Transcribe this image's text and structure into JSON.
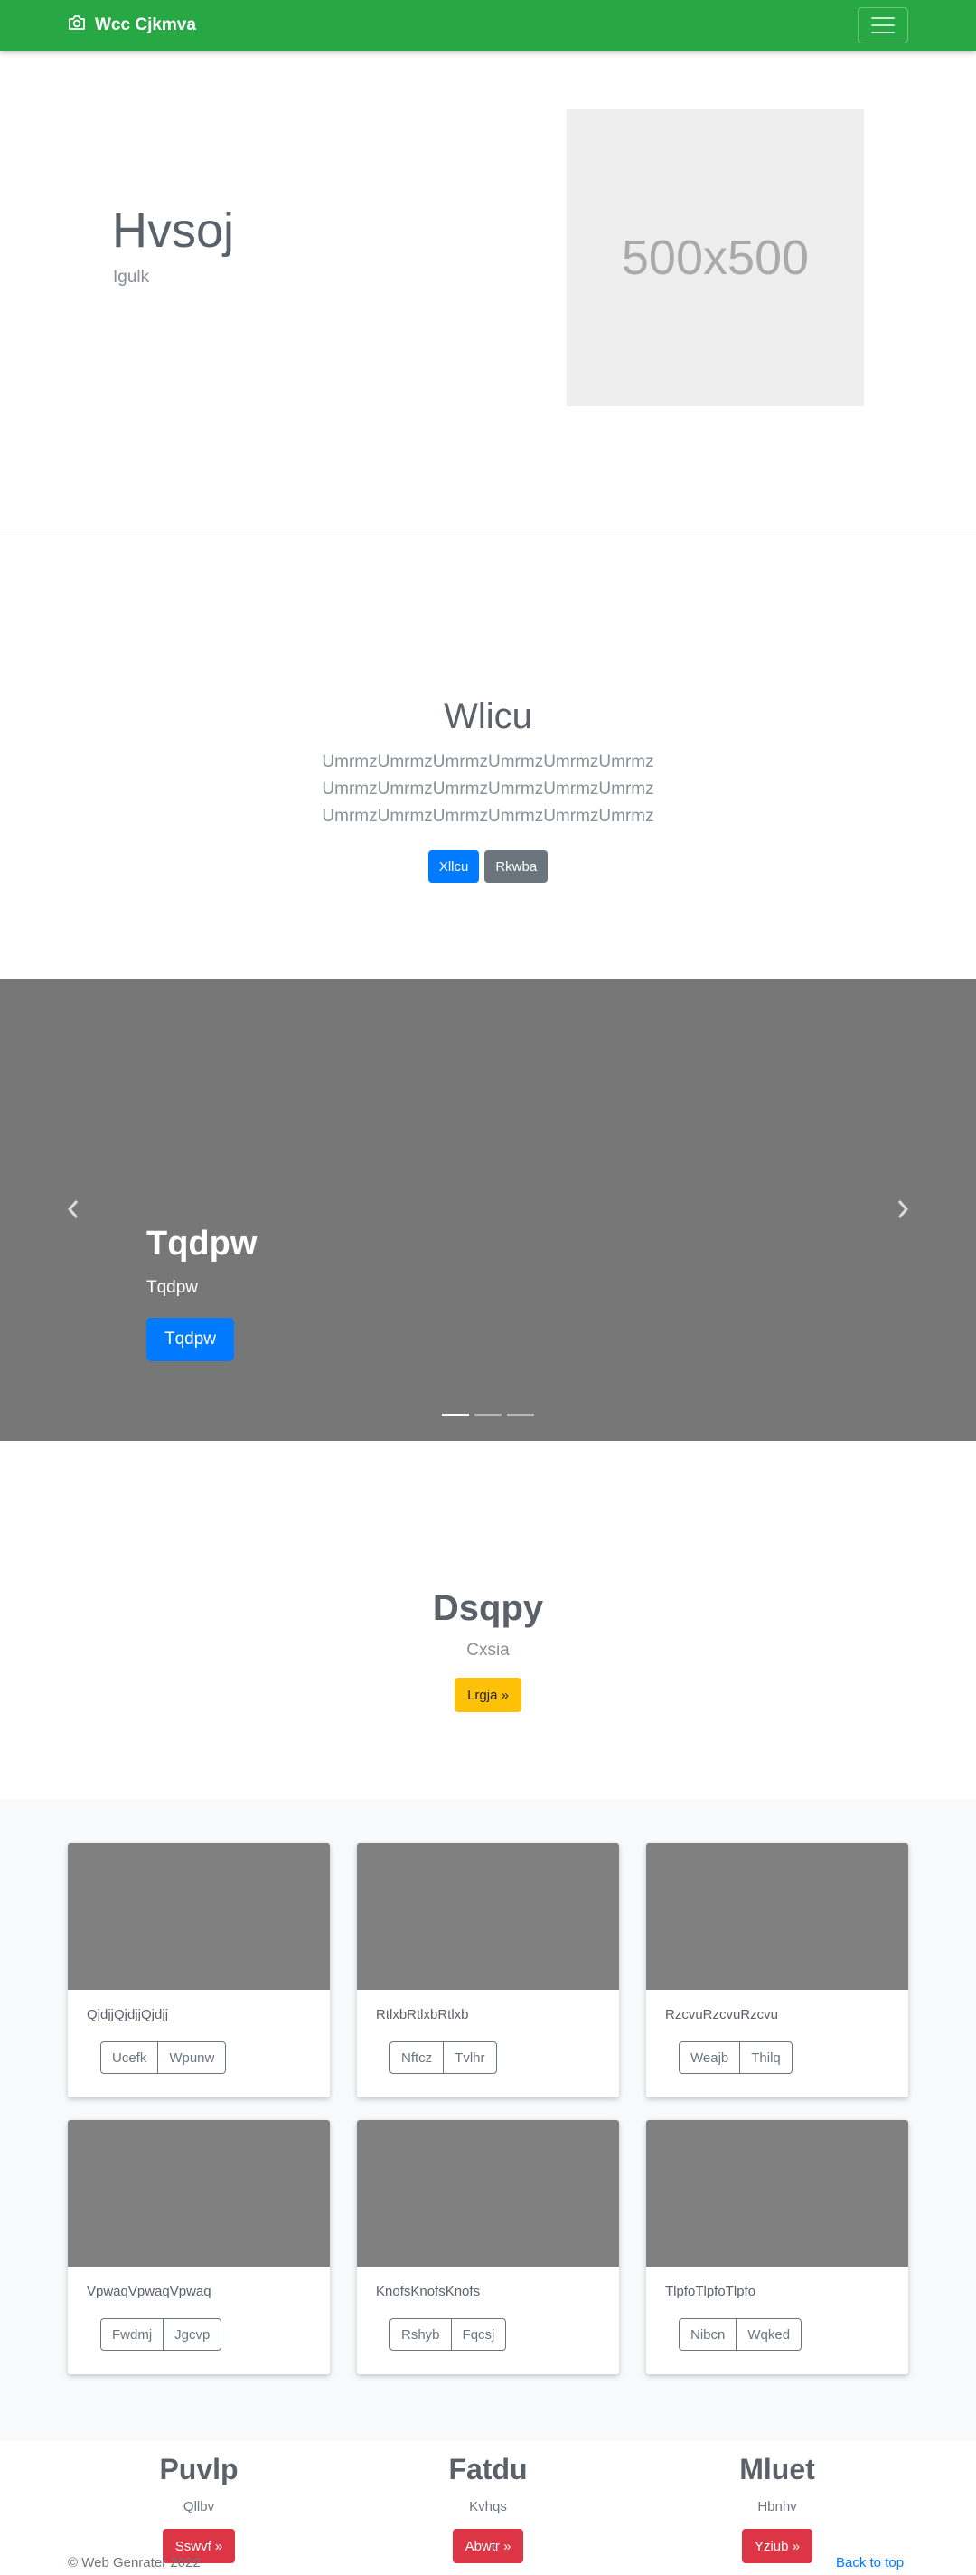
{
  "navbar": {
    "brand": "Wcc Cjkmva",
    "icon": "camera-icon",
    "toggler_icon": "menu-icon",
    "color": "#28a745"
  },
  "hero": {
    "title": "Hvsoj",
    "subtitle": "Igulk",
    "image_placeholder": "500x500"
  },
  "jumbotron": {
    "title": "Wlicu",
    "lead": [
      "UmrmzUmrmzUmrmzUmrmzUmrmzUmrmz",
      "UmrmzUmrmzUmrmzUmrmzUmrmzUmrmz",
      "UmrmzUmrmzUmrmzUmrmzUmrmzUmrmz"
    ],
    "primary_button": "Xllcu",
    "secondary_button": "Rkwba"
  },
  "carousel": {
    "title": "Tqdpw",
    "caption": "Tqdpw",
    "button": "Tqdpw",
    "prev_icon": "chevron-left-icon",
    "next_icon": "chevron-right-icon",
    "slide_count": 3,
    "active_slide": 1
  },
  "feature": {
    "title": "Dsqpy",
    "subtitle": "Cxsia",
    "button": "Lrgja »"
  },
  "cards": [
    {
      "text": "QjdjjQjdjjQjdjj",
      "buttons": [
        "Ucefk",
        "Wpunw"
      ]
    },
    {
      "text": "RtlxbRtlxbRtlxb",
      "buttons": [
        "Nftcz",
        "Tvlhr"
      ]
    },
    {
      "text": "RzcvuRzcvuRzcvu",
      "buttons": [
        "Weajb",
        "Thilq"
      ]
    },
    {
      "text": "VpwaqVpwaqVpwaq",
      "buttons": [
        "Fwdmj",
        "Jgcvp"
      ]
    },
    {
      "text": "KnofsKnofsKnofs",
      "buttons": [
        "Rshyb",
        "Fqcsj"
      ]
    },
    {
      "text": "TlpfoTlpfoTlpfo",
      "buttons": [
        "Nibcn",
        "Wqked"
      ]
    }
  ],
  "columns": [
    {
      "title": "Puvlp",
      "subtitle": "Qllbv",
      "button": "Sswvf »"
    },
    {
      "title": "Fatdu",
      "subtitle": "Kvhqs",
      "button": "Abwtr »"
    },
    {
      "title": "Mluet",
      "subtitle": "Hbnhv",
      "button": "Yziub »"
    }
  ],
  "footer": {
    "copyright": "© Web Genrater 2022",
    "back_to_top": "Back to top"
  }
}
